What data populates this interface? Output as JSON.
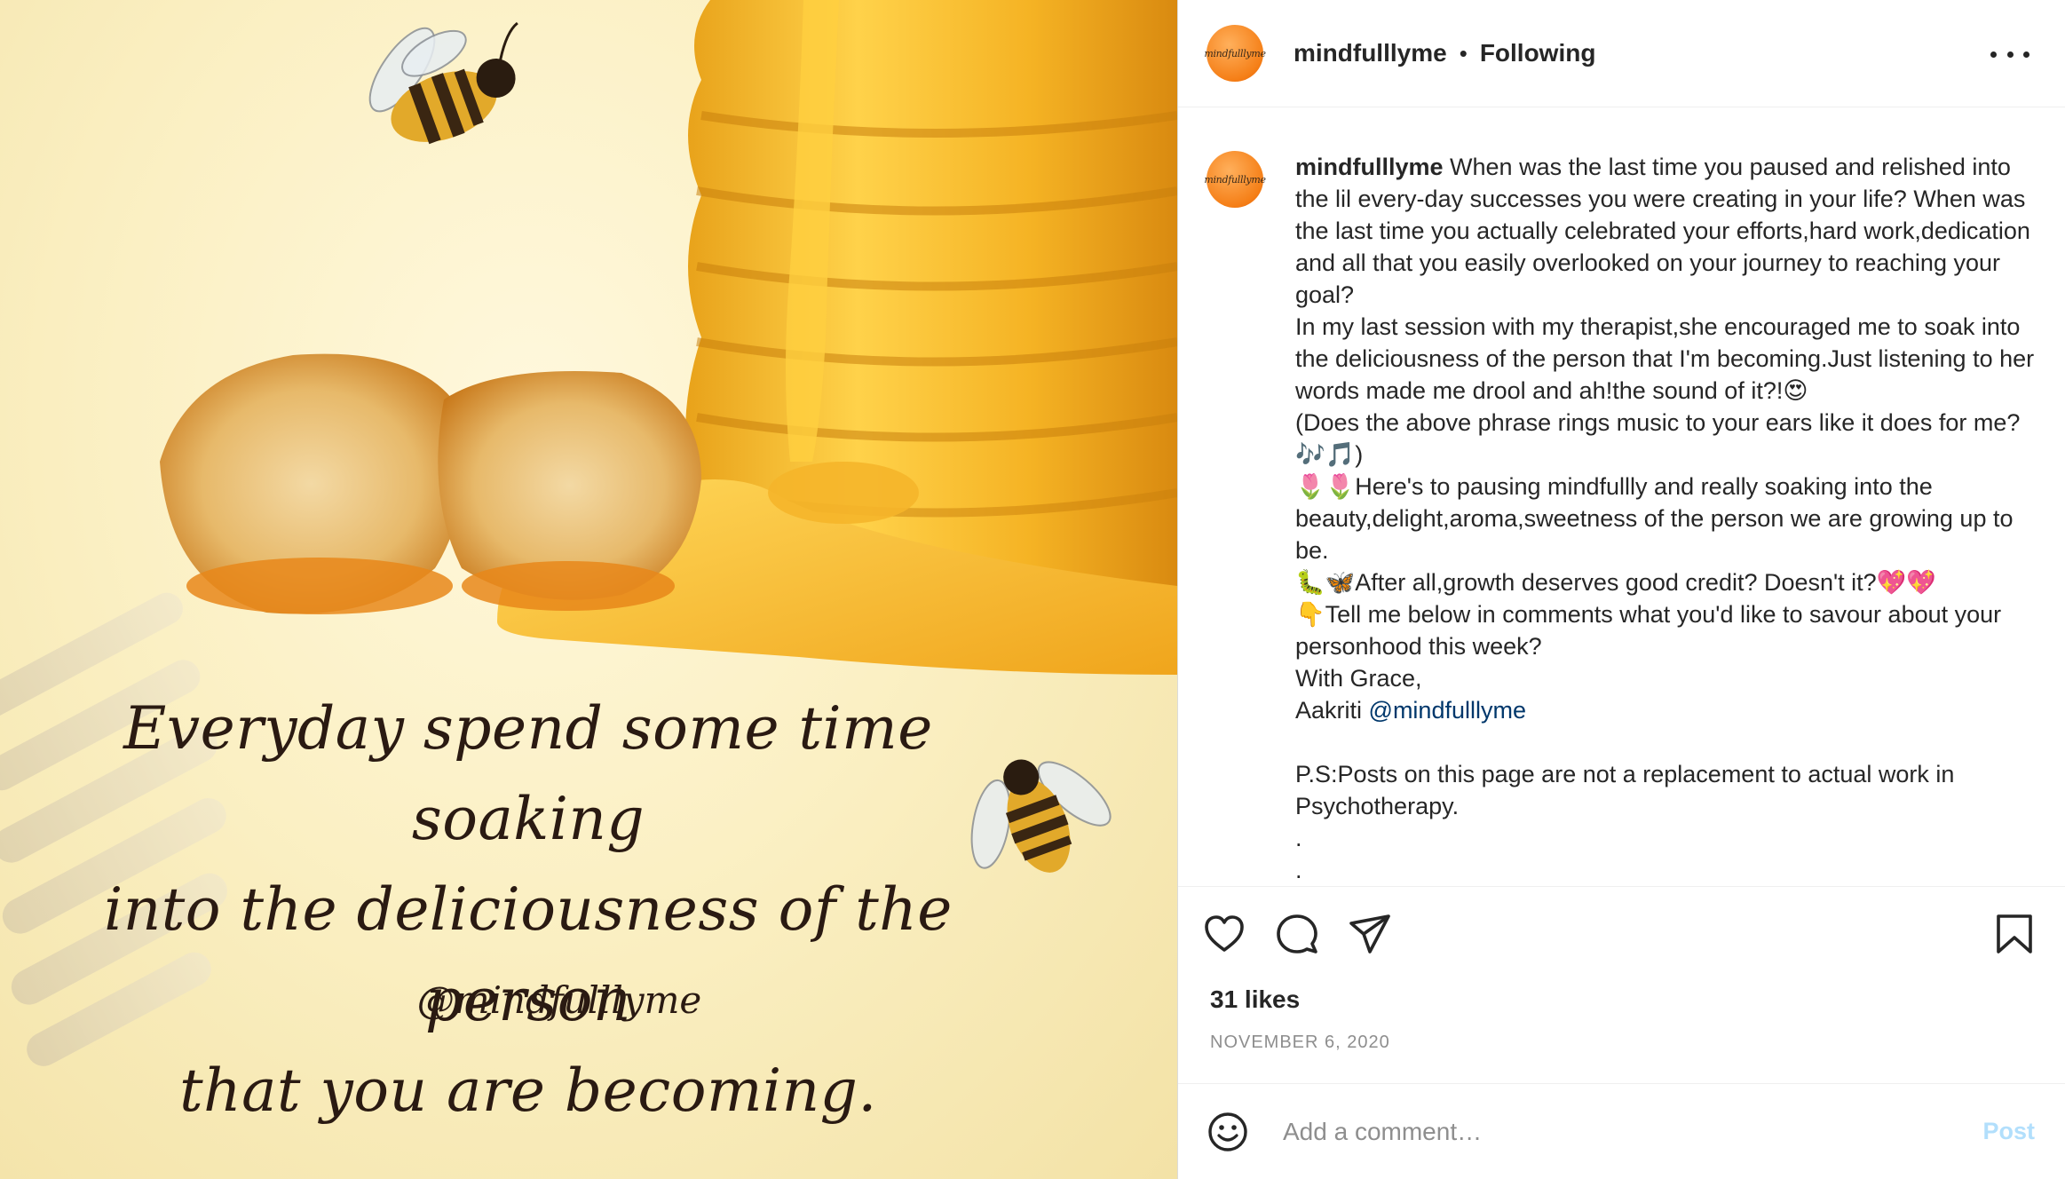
{
  "media": {
    "quote_lines": [
      "Everyday spend some time soaking",
      "into the deliciousness of the person",
      "that you are becoming."
    ],
    "handle": "@mindfulllyme",
    "avatar_mark": "mindfulllyme"
  },
  "header": {
    "username": "mindfulllyme",
    "separator": "•",
    "follow_label": "Following",
    "more_icon": "more-options-icon"
  },
  "caption": {
    "username": "mindfulllyme",
    "body": " When was the last time you paused and relished into the lil every-day successes you were creating in your life? When was the last time you actually celebrated your efforts,hard work,dedication and all that you easily overlooked on your journey to reaching your goal?\nIn my last session with my therapist,she encouraged me to soak into the deliciousness of the person that I'm becoming.Just listening to her words made me drool and ah!the sound of it?!😍\n(Does the above phrase rings music to your ears like it does for me?🎶🎵)\n🌷🌷Here's to pausing mindfullly and really soaking into the beauty,delight,aroma,sweetness of the person we are growing up to be.\n🐛🦋After all,growth deserves good credit? Doesn't it?💖💖\n👇Tell me below in comments what you'd like to savour about your personhood this week?\nWith Grace,\nAakriti ",
    "mention": "@mindfulllyme",
    "footer": "\n\nP.S:Posts on this page are not a replacement to actual work in Psychotherapy.\n.\n."
  },
  "actions": {
    "icons": [
      "heart-icon",
      "comment-icon",
      "share-icon",
      "bookmark-icon"
    ]
  },
  "likes": "31 likes",
  "date": "NOVEMBER 6, 2020",
  "comment": {
    "placeholder": "Add a comment…",
    "post_label": "Post",
    "emoji_icon": "emoji-icon"
  },
  "colors": {
    "text": "#262626",
    "secondary": "#8e8e8e",
    "link": "#00376b",
    "post_disabled": "#b2dffc",
    "avatar": "#f57f17"
  }
}
